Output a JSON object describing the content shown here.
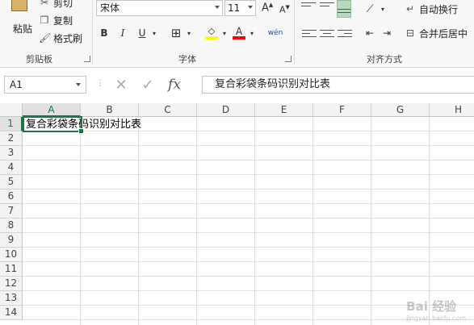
{
  "ribbon": {
    "clipboard": {
      "paste_label": "粘贴",
      "cut_label": "剪切",
      "copy_label": "复制",
      "format_painter_label": "格式刷",
      "group_label": "剪贴板"
    },
    "font": {
      "font_name": "宋体",
      "font_size": "11",
      "bold": "B",
      "italic": "I",
      "underline": "U",
      "grow": "A",
      "shrink": "A",
      "font_color": "A",
      "phonetic": "wén",
      "group_label": "字体"
    },
    "alignment": {
      "wrap_text_label": "自动换行",
      "merge_center_label": "合并后居中",
      "group_label": "对齐方式"
    }
  },
  "formula_bar": {
    "name_box": "A1",
    "fx": "fx",
    "content": "复合彩袋条码识别对比表"
  },
  "sheet": {
    "columns": [
      "A",
      "B",
      "C",
      "D",
      "E",
      "F",
      "G",
      "H"
    ],
    "rows": [
      "1",
      "2",
      "3",
      "4",
      "5",
      "6",
      "7",
      "8",
      "9",
      "10",
      "11",
      "12",
      "13",
      "14"
    ],
    "a1_value": "复合彩袋条码识别对比表"
  },
  "watermark": {
    "text": "Bai 经验",
    "sub": "jingyan.baidu.com"
  },
  "colors": {
    "accent": "#217346",
    "highlight_yellow": "#ffff00",
    "font_red": "#ff0000"
  }
}
